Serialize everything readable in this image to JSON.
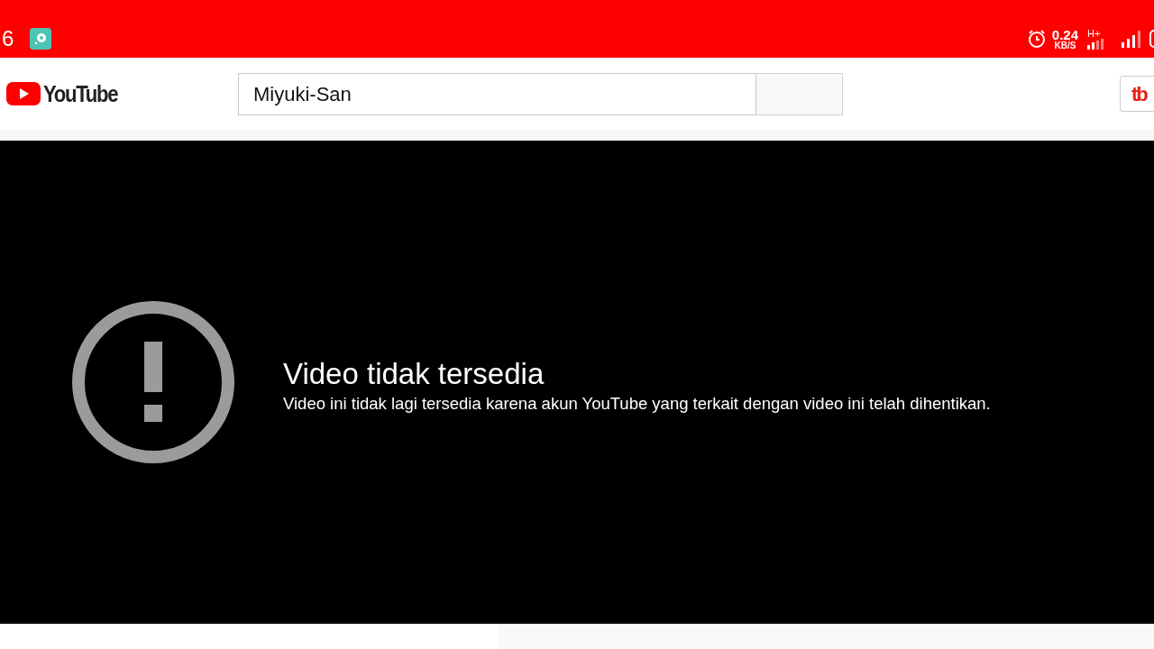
{
  "status_bar": {
    "time": "6",
    "net_speed": "0.24",
    "net_speed_unit": "KB/S",
    "network_type": "H+"
  },
  "header": {
    "logo_text": "YouTube",
    "search": {
      "value": "Miyuki-San"
    },
    "extension_button_text": "tb"
  },
  "player": {
    "error_title": "Video tidak tersedia",
    "error_message": "Video ini tidak lagi tersedia karena akun YouTube yang terkait dengan video ini telah dihentikan."
  }
}
